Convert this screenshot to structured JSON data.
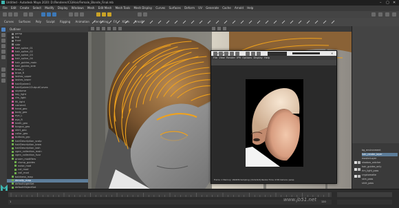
{
  "window": {
    "title": "Untitled - Autodesk Maya 2020: D:/Renderer/CG/Hair/Female_Blonde_Final.mb",
    "controls": [
      "–",
      "▢",
      "✕"
    ]
  },
  "menubar": [
    "File",
    "Edit",
    "Create",
    "Select",
    "Modify",
    "Display",
    "Windows",
    "Mesh",
    "Edit Mesh",
    "Mesh Tools",
    "Mesh Display",
    "Curves",
    "Surfaces",
    "Deform",
    "UV",
    "Generate",
    "Cache",
    "Arnold",
    "Help"
  ],
  "shelf_tabs": [
    "Curves",
    "Surfaces",
    "Poly",
    "Sculpt",
    "Rigging",
    "Animation",
    "Rendering",
    "FX",
    "XGen",
    "Arnold"
  ],
  "outliner": {
    "header": "Outliner",
    "items": [
      {
        "label": "persp",
        "color": "#8a8a8a",
        "indent": 1
      },
      {
        "label": "top",
        "color": "#8a8a8a",
        "indent": 1
      },
      {
        "label": "front",
        "color": "#8a8a8a",
        "indent": 1
      },
      {
        "label": "side",
        "color": "#8a8a8a",
        "indent": 1
      },
      {
        "label": "hair_spline_01",
        "color": "#d05a9a",
        "indent": 1
      },
      {
        "label": "hair_spline_02",
        "color": "#d05a9a",
        "indent": 1
      },
      {
        "label": "hair_spline_03",
        "color": "#d05a9a",
        "indent": 1
      },
      {
        "label": "hair_spline_04",
        "color": "#d05a9a",
        "indent": 1
      },
      {
        "label": "hair_guides_main",
        "color": "#d05a9a",
        "indent": 1
      },
      {
        "label": "hair_guides_side",
        "color": "#d05a9a",
        "indent": 1
      },
      {
        "label": "brow_L",
        "color": "#d05a9a",
        "indent": 1
      },
      {
        "label": "brow_R",
        "color": "#d05a9a",
        "indent": 1
      },
      {
        "label": "lashes_upper",
        "color": "#d05a9a",
        "indent": 1
      },
      {
        "label": "lashes_lower",
        "color": "#d05a9a",
        "indent": 1
      },
      {
        "label": "hairSystem1",
        "color": "#d05a9a",
        "indent": 1
      },
      {
        "label": "hairSystem1OutputCurves",
        "color": "#d05a9a",
        "indent": 1
      },
      {
        "label": "skydome",
        "color": "#d05a9a",
        "indent": 1
      },
      {
        "label": "key_light",
        "color": "#d05a9a",
        "indent": 1
      },
      {
        "label": "rim_light",
        "color": "#d05a9a",
        "indent": 1
      },
      {
        "label": "fill_light",
        "color": "#d05a9a",
        "indent": 1
      },
      {
        "label": "camera1",
        "color": "#d05a9a",
        "indent": 1
      },
      {
        "label": "head_geo",
        "color": "#d05a9a",
        "indent": 1
      },
      {
        "label": "body_geo",
        "color": "#d05a9a",
        "indent": 1
      },
      {
        "label": "eye_L",
        "color": "#d05a9a",
        "indent": 1
      },
      {
        "label": "eye_R",
        "color": "#d05a9a",
        "indent": 1
      },
      {
        "label": "teeth_geo",
        "color": "#d05a9a",
        "indent": 1
      },
      {
        "label": "tongue_geo",
        "color": "#d05a9a",
        "indent": 1
      },
      {
        "label": "shirt_geo",
        "color": "#d05a9a",
        "indent": 1
      },
      {
        "label": "collar_geo",
        "color": "#d05a9a",
        "indent": 1
      },
      {
        "label": "buttons_grp",
        "color": "#d05a9a",
        "indent": 1
      },
      {
        "label": "hairDescription_scalp",
        "color": "#6fae4c",
        "indent": 1
      },
      {
        "label": "hairDescription_brow",
        "color": "#6fae4c",
        "indent": 1
      },
      {
        "label": "hairDescription_lash",
        "color": "#6fae4c",
        "indent": 1
      },
      {
        "label": "xgen_collection_main",
        "color": "#6fae4c",
        "indent": 1
      },
      {
        "label": "xgen_collection_fuzz",
        "color": "#6fae4c",
        "indent": 1
      },
      {
        "label": "groom_modifiers",
        "color": "#6fae4c",
        "indent": 1
      },
      {
        "label": "clump_guides",
        "color": "#6fae4c",
        "indent": 2
      },
      {
        "label": "noise_mod",
        "color": "#6fae4c",
        "indent": 2
      },
      {
        "label": "cut_mod",
        "color": "#6fae4c",
        "indent": 2
      },
      {
        "label": "coil_mod",
        "color": "#6fae4c",
        "indent": 2
      },
      {
        "label": "baldness_map",
        "color": "#6fae4c",
        "indent": 1
      },
      {
        "label": "density_map",
        "color": "#6fae4c",
        "indent": 1
      },
      {
        "label": "defaultLightSet",
        "color": "#6fae4c",
        "indent": 1
      },
      {
        "label": "defaultObjectSet",
        "color": "#6fae4c",
        "indent": 1
      }
    ],
    "selected_index": 41
  },
  "image_window": {
    "title": "renderView",
    "menu": [
      "File",
      "View",
      "Render",
      "IPR",
      "Options",
      "Display",
      "Help"
    ],
    "footer": "Frame: 1   Memory: 1824Mb   Sampling: [3/2/2/2/2]   Render Time: 0:58   Camera: persp"
  },
  "layers": {
    "items": [
      "bg_environment",
      "hair_render_layer",
      "masterLayer",
      "shadow_catcher",
      "hair_guides_only",
      "rim_light_pass",
      "cryptomatte",
      "skin_pass",
      "shirt_pass"
    ],
    "selected_index": 1
  },
  "timeline": {
    "start": "1",
    "end": "120",
    "current": "1"
  },
  "watermark": "www.jb51.net",
  "colors": {
    "guide_curves": "#f0a21c",
    "selection": "#5d7d9a",
    "maya_logo": "#3fb6b0"
  },
  "icons": [
    "select-icon",
    "lasso-icon",
    "paint-icon",
    "move-icon",
    "rotate-icon",
    "scale-icon",
    "render-icon",
    "ipr-icon",
    "snapshot-icon",
    "maya-logo-icon"
  ]
}
